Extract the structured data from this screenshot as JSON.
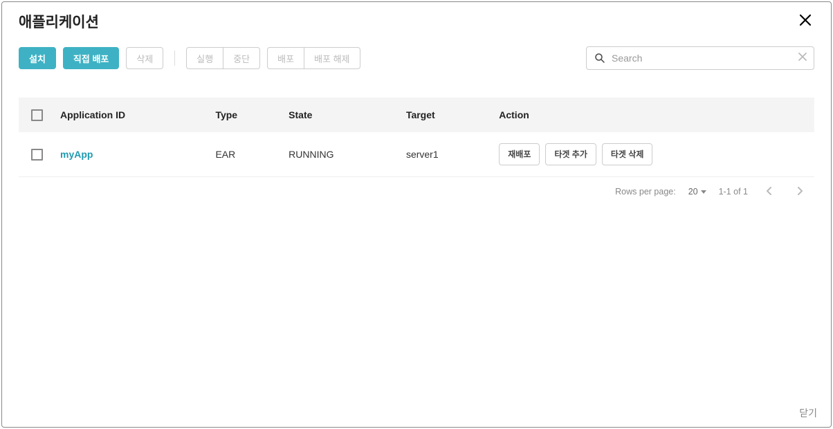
{
  "dialog": {
    "title": "애플리케이션",
    "close_label": "닫기"
  },
  "toolbar": {
    "install": "설치",
    "direct_deploy": "직접 배포",
    "delete": "삭제",
    "run": "실행",
    "stop": "중단",
    "deploy": "배포",
    "undeploy": "배포 해제"
  },
  "search": {
    "placeholder": "Search"
  },
  "table": {
    "headers": {
      "app_id": "Application ID",
      "type": "Type",
      "state": "State",
      "target": "Target",
      "action": "Action"
    },
    "rows": [
      {
        "app_id": "myApp",
        "type": "EAR",
        "state": "RUNNING",
        "target": "server1",
        "actions": {
          "redeploy": "재배포",
          "add_target": "타겟 추가",
          "delete_target": "타겟 삭제"
        }
      }
    ]
  },
  "pagination": {
    "rows_label": "Rows per page:",
    "rows_value": "20",
    "range": "1-1 of 1"
  }
}
